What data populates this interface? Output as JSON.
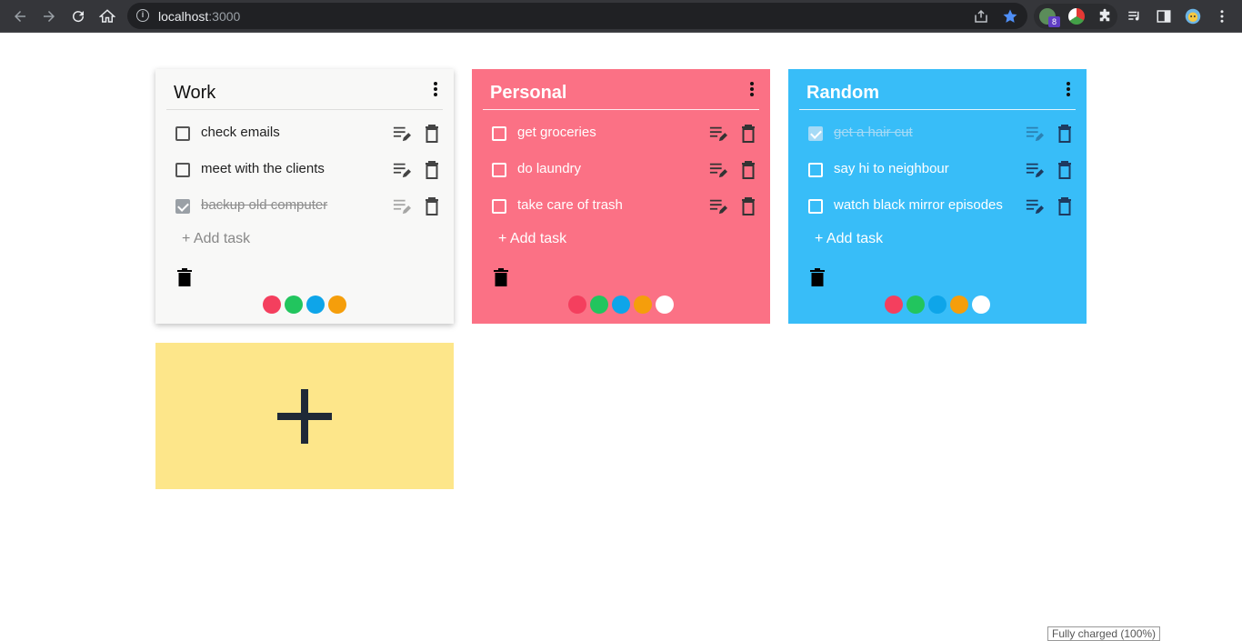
{
  "browser": {
    "url_host": "localhost",
    "url_port": ":3000",
    "extension_badge": "8"
  },
  "columns": [
    {
      "title": "Work",
      "tasks": [
        {
          "text": "check emails",
          "done": false
        },
        {
          "text": "meet with the clients",
          "done": false
        },
        {
          "text": "backup old computer",
          "done": true
        }
      ],
      "add_task_label": "+ Add task",
      "palette": [
        "#f43f5e",
        "#22c55e",
        "#0ea5e9",
        "#f59e0b"
      ]
    },
    {
      "title": "Personal",
      "tasks": [
        {
          "text": "get groceries",
          "done": false
        },
        {
          "text": "do laundry",
          "done": false
        },
        {
          "text": "take care of trash",
          "done": false
        }
      ],
      "add_task_label": "+ Add task",
      "palette": [
        "#f43f5e",
        "#22c55e",
        "#0ea5e9",
        "#f59e0b",
        "#ffffff"
      ]
    },
    {
      "title": "Random",
      "tasks": [
        {
          "text": "get a hair cut",
          "done": true
        },
        {
          "text": "say hi to neighbour",
          "done": false
        },
        {
          "text": "watch black mirror episodes",
          "done": false
        }
      ],
      "add_task_label": "+ Add task",
      "palette": [
        "#f43f5e",
        "#22c55e",
        "#0ea5e9",
        "#f59e0b",
        "#ffffff"
      ]
    }
  ],
  "add_board_symbol": "+",
  "tooltip": "Fully charged (100%)",
  "colors": {
    "work_bg": "#f8f8f7",
    "personal_bg": "#fb7185",
    "random_bg": "#38bdf8",
    "add_card_bg": "#fde68a"
  }
}
